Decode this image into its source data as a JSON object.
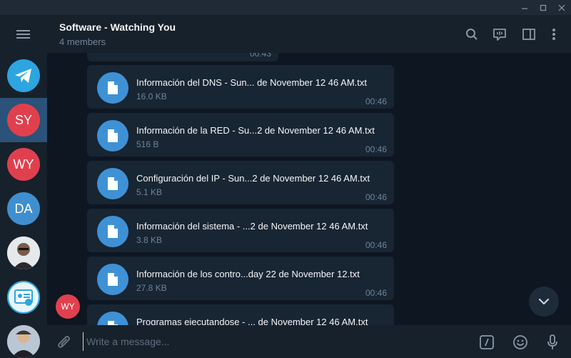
{
  "window": {
    "controls": [
      "minimize",
      "maximize",
      "close"
    ]
  },
  "chat": {
    "title": "Software - Watching You",
    "subtitle": "4 members"
  },
  "sidebar": {
    "chats": [
      {
        "initials": "",
        "icon": "telegram-icon",
        "color": "#2ca5e0"
      },
      {
        "initials": "SY",
        "color": "#e0404e",
        "active": true
      },
      {
        "initials": "WY",
        "color": "#e0404e"
      },
      {
        "initials": "DA",
        "color": "#3f8fcf"
      },
      {
        "initials": "",
        "icon": "photo-avatar"
      },
      {
        "initials": "",
        "icon": "id-card-avatar"
      },
      {
        "initials": "",
        "icon": "photo-avatar"
      }
    ]
  },
  "messages": {
    "previous_time": "00:43",
    "files": [
      {
        "name": "Información del DNS - Sun... de November 12 46 AM.txt",
        "size": "16.0 KB",
        "time": "00:46"
      },
      {
        "name": "Información de la RED - Su...2 de November 12 46 AM.txt",
        "size": "516 B",
        "time": "00:46"
      },
      {
        "name": "Configuración del IP - Sun...2 de November 12 46 AM.txt",
        "size": "5.1 KB",
        "time": "00:46"
      },
      {
        "name": "Información del sistema - ...2 de November 12 46 AM.txt",
        "size": "3.8 KB",
        "time": "00:46"
      },
      {
        "name": "Información de los contro...day 22 de November 12.txt",
        "size": "27.8 KB",
        "time": "00:46"
      },
      {
        "name": "Programas ejecutandose - ... de November 12 46 AM.txt",
        "size": "",
        "time": ""
      }
    ],
    "sender_initials": "WY"
  },
  "composer": {
    "placeholder": "Write a message..."
  },
  "colors": {
    "accent": "#3f91d6",
    "background": "#0e1621",
    "panel": "#17212b",
    "bubble": "#182533"
  }
}
